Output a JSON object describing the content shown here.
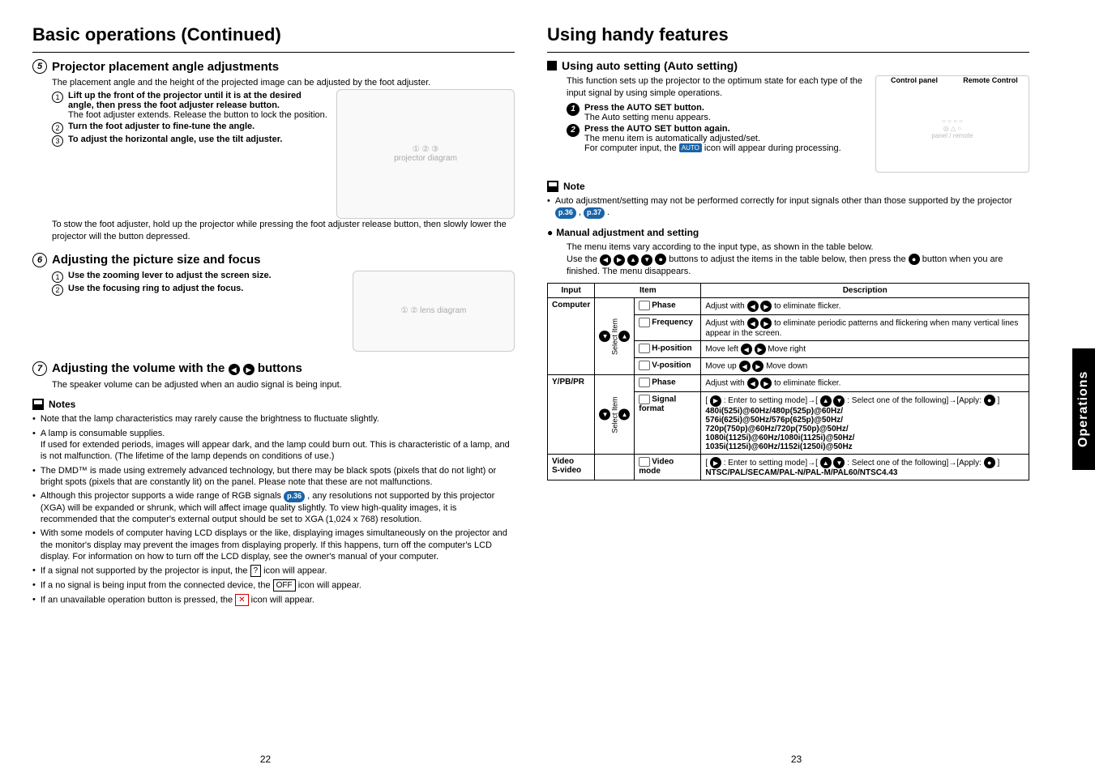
{
  "left": {
    "h1": "Basic operations (Continued)",
    "s5": {
      "title": "Projector placement angle adjustments",
      "intro": "The placement angle and the height of the projected image can be adjusted by the foot adjuster.",
      "steps": [
        {
          "bold": "Lift up the front of the projector until it is at the desired angle, then press the foot adjuster release button.",
          "plain": "The foot adjuster extends. Release the button to lock the position."
        },
        {
          "bold": "Turn the foot adjuster to fine-tune the angle.",
          "plain": ""
        },
        {
          "bold": "To adjust the horizontal angle, use the tilt adjuster.",
          "plain": ""
        }
      ],
      "footer": "To stow the foot adjuster, hold up the projector while pressing the foot adjuster release button, then slowly lower the projector will the button depressed."
    },
    "s6": {
      "title": "Adjusting the picture size and focus",
      "steps": [
        {
          "bold": "Use the zooming lever to adjust the screen size."
        },
        {
          "bold": "Use the focusing ring to adjust the focus."
        }
      ]
    },
    "s7": {
      "title_pre": "Adjusting the volume with the ",
      "title_post": " buttons",
      "intro": "The speaker volume can be adjusted when an audio signal is being input."
    },
    "notes_label": "Notes",
    "notes": [
      "Note that the lamp characteristics may rarely cause the brightness to fluctuate slightly.",
      "A lamp is consumable supplies.\nIf used for extended periods, images will appear dark, and the lamp could burn out.  This is characteristic of a lamp, and is not malfunction. (The lifetime of the lamp depends on conditions of use.)",
      "The DMD™ is made using extremely advanced technology, but there may be black spots (pixels that do not light) or bright spots (pixels that are constantly lit) on the panel. Please note that these are not malfunctions.",
      "Although this projector supports a wide range of RGB signals [p.36] , any resolutions not supported by this projector (XGA) will be expanded or shrunk, which will affect image quality slightly. To view high-quality images, it is recommended that the computer's external output should be set to XGA (1,024 x 768) resolution.",
      "With some models of computer having LCD displays or the like, displaying images simultaneously on the projector and the monitor's display may prevent the images from displaying properly. If this happens, turn off the computer's LCD display. For information on how to turn off the LCD display, see the owner's manual of your computer.",
      "If a signal not supported by the projector is input, the [?] icon will appear.",
      "If a no signal is being input from the connected device, the [OFF] icon will appear.",
      "If an unavailable operation button is pressed, the [X] icon will appear."
    ],
    "pagenum": "22"
  },
  "right": {
    "h1": "Using handy features",
    "auto": {
      "heading": "Using auto setting (Auto setting)",
      "intro": "This function sets up the projector to the optimum state for each type of the input signal by using simple operations.",
      "diag_labels": {
        "cp": "Control panel",
        "rc": "Remote Control"
      },
      "steps": [
        {
          "bold": "Press the AUTO SET button.",
          "plain": "The Auto setting menu appears."
        },
        {
          "bold": "Press the AUTO SET button again.",
          "plain": "The menu item is automatically adjusted/set.\nFor computer input, the [AUTO] icon will appear during processing."
        }
      ]
    },
    "note_label": "Note",
    "note_text_a": "Auto adjustment/setting may not be performed correctly for input signals other than those supported by the projector ",
    "note_ref1": "p.36",
    "note_ref2": "p.37",
    "manual": {
      "heading": "Manual adjustment and setting",
      "p1": "The menu items vary according to the input type, as shown in the table below.",
      "p2a": "Use the ",
      "p2b": " buttons to adjust the items in the table below, then press the ",
      "p2c": " button when you are finished. The menu disappears."
    },
    "table": {
      "headers": {
        "input": "Input",
        "item": "Item",
        "desc": "Description"
      },
      "inputs": {
        "computer": "Computer",
        "ypbpr": "Y/PB/PR",
        "video": "Video\nS-video"
      },
      "select_item": "Select Item",
      "rows": {
        "phase": {
          "item": "Phase",
          "desc": "Adjust with ◀ ▶ to eliminate flicker."
        },
        "freq": {
          "item": "Frequency",
          "desc": "Adjust with ◀ ▶ to eliminate periodic patterns and flickering when many vertical lines appear in the screen."
        },
        "hpos": {
          "item": "H-position",
          "desc": "Move left ◀ ▶ Move right"
        },
        "vpos": {
          "item": "V-position",
          "desc": "Move up ◀ ▶ Move down"
        },
        "phase2": {
          "item": "Phase",
          "desc": "Adjust with ◀ ▶ to eliminate flicker."
        },
        "sigfmt": {
          "item": "Signal format",
          "desc": "[ ▶ : Enter to setting mode]→[ ▲ ▼ : Select one of the following]→[Apply: ● ]\n480i(525i)@60Hz/480p(525p)@60Hz/\n576i(625i)@50Hz/576p(625p)@50Hz/\n720p(750p)@60Hz/720p(750p)@50Hz/\n1080i(1125i)@60Hz/1080i(1125i)@50Hz/\n1035i(1125i)@60Hz/1152i(1250i)@50Hz"
        },
        "vmode": {
          "item": "Video mode",
          "desc": "[ ▶ : Enter to setting mode]→[ ▲ ▼ : Select one of the following]→[Apply: ● ]\nNTSC/PAL/SECAM/PAL-N/PAL-M/PAL60/NTSC4.43"
        }
      }
    },
    "side_tab": "Operations",
    "pagenum": "23"
  }
}
